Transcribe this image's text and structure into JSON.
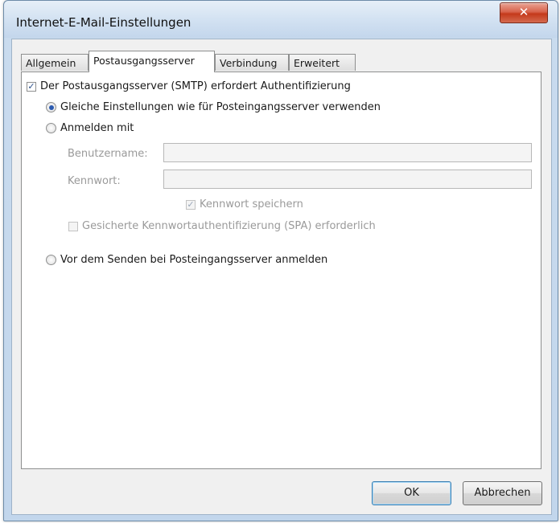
{
  "window": {
    "title": "Internet-E-Mail-Einstellungen",
    "close_glyph": "✕"
  },
  "tabs": [
    {
      "label": "Allgemein",
      "active": false
    },
    {
      "label": "Postausgangsserver",
      "active": true
    },
    {
      "label": "Verbindung",
      "active": false
    },
    {
      "label": "Erweitert",
      "active": false
    }
  ],
  "outgoing": {
    "smtp_auth_label": "Der Postausgangsserver (SMTP) erfordert Authentifizierung",
    "smtp_auth_checked": true,
    "same_settings_label": "Gleiche Einstellungen wie für Posteingangsserver verwenden",
    "same_settings_selected": true,
    "login_with_label": "Anmelden mit",
    "username_label": "Benutzername:",
    "username_value": "",
    "password_label": "Kennwort:",
    "password_value": "",
    "remember_password_label": "Kennwort speichern",
    "remember_password_checked": true,
    "spa_label": "Gesicherte Kennwortauthentifizierung (SPA) erforderlich",
    "spa_checked": false,
    "login_before_send_label": "Vor dem Senden bei Posteingangsserver anmelden"
  },
  "buttons": {
    "ok": "OK",
    "cancel": "Abbrechen"
  },
  "colors": {
    "title_bar": "#c9dbee",
    "close_button": "#c4391b",
    "radio_dot": "#2c5bb0"
  }
}
